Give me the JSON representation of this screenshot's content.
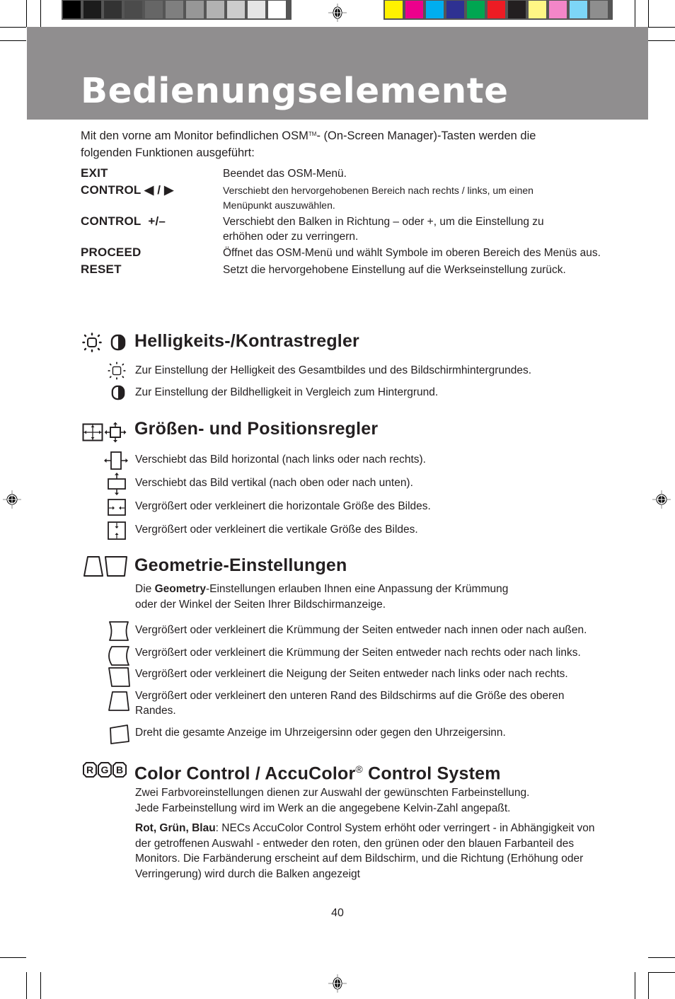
{
  "print_marks": {
    "grayscale_swatches": [
      "#000000",
      "#1c1c1c",
      "#333333",
      "#4b4b4b",
      "#666666",
      "#7f7f7f",
      "#979797",
      "#b2b2b2",
      "#cccccc",
      "#e5e5e5",
      "#ffffff"
    ],
    "color_swatches": [
      "#fff200",
      "#ec008c",
      "#00aeef",
      "#2e3192",
      "#00a651",
      "#ed1c24",
      "#231f20",
      "#fff685",
      "#f386c8",
      "#7dd6f7",
      "#8e8e8e"
    ]
  },
  "colors": {
    "header_bar": "#908e8f",
    "text": "#231f20"
  },
  "page": {
    "title": "Bedienungselemente",
    "intro_part1": "Mit den vorne am Monitor befindlichen OSM",
    "intro_tm": "TM",
    "intro_part2": "- (On-Screen Manager)-Tasten werden die folgenden Funktionen ausgeführt:",
    "number": "40"
  },
  "keys": [
    {
      "name": "EXIT",
      "icon": "",
      "description": "Beendet das OSM-Menü."
    },
    {
      "name": "CONTROL",
      "icon": "left-right-triangles",
      "icon_text": "◀ / ▶",
      "description": "Verschiebt den hervorgehobenen Bereich nach rechts / links, um einen Menüpunkt auszuwählen."
    },
    {
      "name": "CONTROL",
      "icon_text": "+/–",
      "description": "Verschiebt den Balken in Richtung – oder +, um die Einstellung zu erhöhen oder zu verringern."
    },
    {
      "name": "PROCEED",
      "description": "Öffnet das OSM-Menü und wählt Symbole im oberen Bereich des Menüs aus."
    },
    {
      "name": "RESET",
      "description": "Setzt die hervorgehobene Einstellung auf die Werkseinstellung zurück."
    }
  ],
  "sections": {
    "brightness": {
      "title": "Helligkeits-/Kontrastregler",
      "icons": [
        "sun-icon",
        "contrast-icon"
      ],
      "items": [
        {
          "icon": "sun-icon",
          "text": "Zur Einstellung der Helligkeit des Gesamtbildes und des Bildschirmhintergrundes."
        },
        {
          "icon": "contrast-icon",
          "text": "Zur Einstellung der Bildhelligkeit in Vergleich zum Hintergrund."
        }
      ]
    },
    "size_position": {
      "title": "Größen- und Positionsregler",
      "icons": [
        "size-icon",
        "position-icon"
      ],
      "items": [
        {
          "icon": "h-position-icon",
          "text": "Verschiebt das Bild horizontal (nach links oder nach rechts)."
        },
        {
          "icon": "v-position-icon",
          "text": "Verschiebt das Bild vertikal (nach oben oder nach unten)."
        },
        {
          "icon": "h-size-icon",
          "text": "Vergrößert oder verkleinert die horizontale Größe des Bildes."
        },
        {
          "icon": "v-size-icon",
          "text": "Vergrößert oder verkleinert die vertikale Größe des Bildes."
        }
      ]
    },
    "geometry": {
      "title": "Geometrie-Einstellungen",
      "icons": [
        "trapezoid-icon",
        "parallelogram-icon"
      ],
      "intro_prefix": "Die ",
      "intro_bold": "Geometry",
      "intro_rest": "-Einstellungen erlauben Ihnen eine Anpassung der Krümmung",
      "intro_line2": "oder der Winkel der Seiten Ihrer Bildschirmanzeige.",
      "items": [
        {
          "icon": "pincushion-icon",
          "text": "Vergrößert oder verkleinert die Krümmung der Seiten entweder nach innen oder nach außen."
        },
        {
          "icon": "pincushion-balance-icon",
          "text": "Vergrößert oder verkleinert die Krümmung der Seiten entweder nach rechts oder nach links."
        },
        {
          "icon": "parallelogram-icon",
          "text": "Vergrößert oder verkleinert die Neigung der Seiten entweder nach links oder nach rechts."
        },
        {
          "icon": "trapezoid-icon",
          "text": "Vergrößert oder verkleinert den unteren Rand des Bildschirms auf die Größe des oberen Randes."
        },
        {
          "icon": "rotate-icon",
          "text": "Dreht die gesamte Anzeige im Uhrzeigersinn oder gegen den Uhrzeigersinn."
        }
      ]
    },
    "color": {
      "title_part1": "Color Control / AccuColor",
      "title_reg": "®",
      "title_part2": " Control System",
      "icon": "rgb-icon",
      "icon_letters": [
        "R",
        "G",
        "B"
      ],
      "line1": "Zwei Farbvoreinstellungen dienen zur Auswahl der gewünschten Farbeinstellung.",
      "line2": "Jede Farbeinstellung wird im Werk an die angegebene Kelvin-Zahl angepaßt.",
      "rgb_bold": "Rot, Grün, Blau",
      "rgb_text": ": NECs AccuColor Control System erhöht oder verringert - in Abhängigkeit von der getroffenen Auswahl - entweder den roten, den grünen oder den blauen Farbanteil des Monitors. Die Farbänderung erscheint auf dem Bildschirm, und die Richtung (Erhöhung oder Verringerung) wird durch die Balken angezeigt"
    }
  }
}
